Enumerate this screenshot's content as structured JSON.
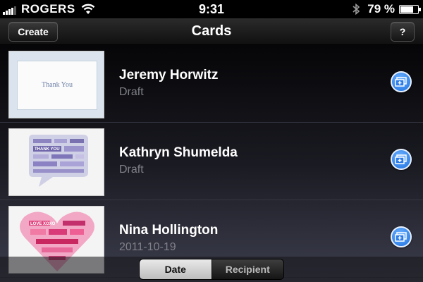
{
  "status_bar": {
    "carrier": "ROGERS",
    "time": "9:31",
    "battery_percent": "79 %",
    "battery_level": 0.79
  },
  "nav": {
    "create_label": "Create",
    "title": "Cards",
    "help_label": "?"
  },
  "cards": [
    {
      "recipient": "Jeremy Horwitz",
      "status": "Draft",
      "thumb_text": "Thank You"
    },
    {
      "recipient": "Kathryn Shumelda",
      "status": "Draft",
      "thumb_text": "THANK YOU"
    },
    {
      "recipient": "Nina Hollington",
      "status": "2011-10-19",
      "thumb_text": "LOVE XOXO"
    }
  ],
  "sort": {
    "date_label": "Date",
    "recipient_label": "Recipient",
    "selected": "Date"
  },
  "colors": {
    "accent_blue": "#1b6fe0",
    "secondary_text": "#7f8088"
  }
}
